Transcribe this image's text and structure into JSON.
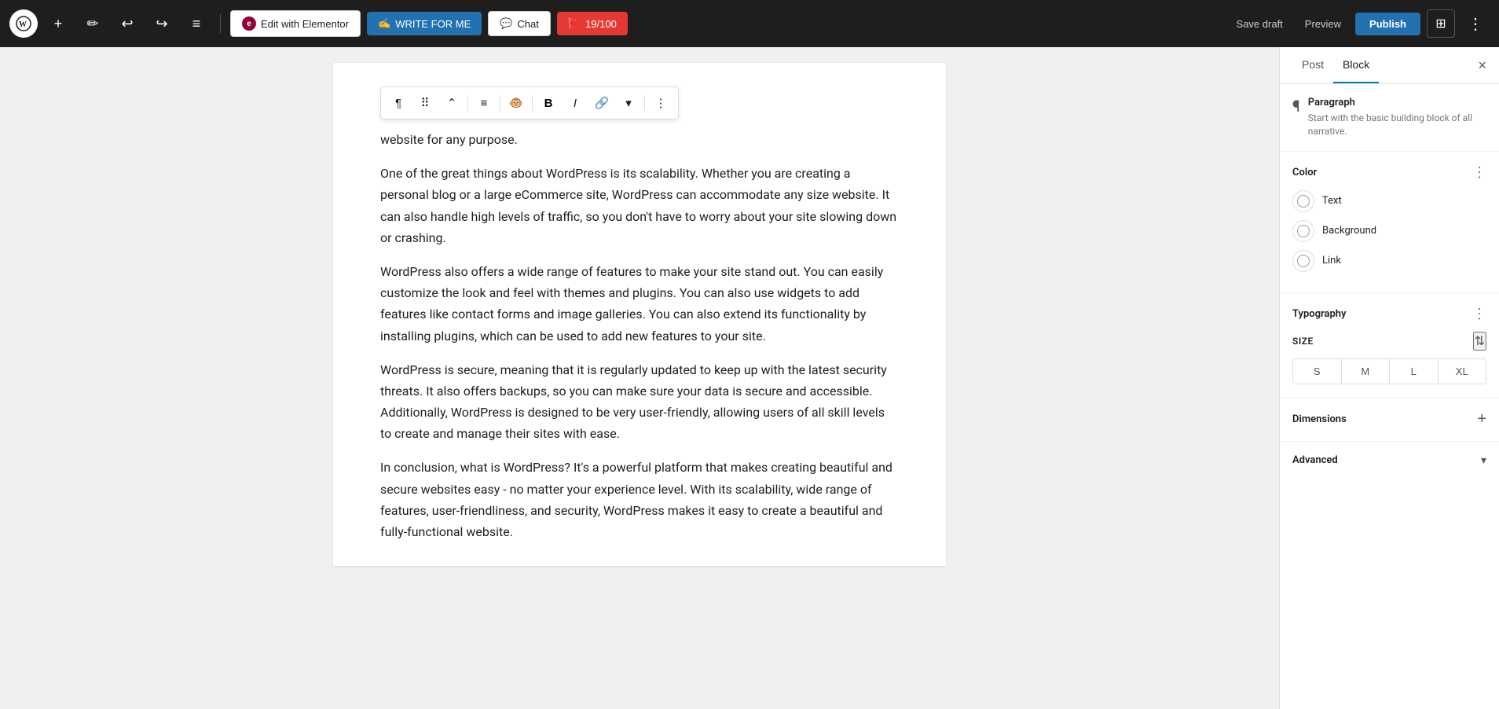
{
  "toolbar": {
    "elementor_btn": "Edit with Elementor",
    "write_btn": "WRITE FOR ME",
    "chat_btn": "Chat",
    "counter_label": "19/100",
    "save_draft_label": "Save draft",
    "preview_label": "Preview",
    "publish_label": "Publish"
  },
  "block_toolbar": {
    "paragraph_icon": "¶",
    "drag_icon": "⠿",
    "move_up_icon": "⌃",
    "align_icon": "≡",
    "avatar_icon": "🐵",
    "bold_icon": "B",
    "italic_icon": "I",
    "link_icon": "🔗",
    "dropdown_icon": "▾",
    "more_icon": "⋮"
  },
  "editor": {
    "content": [
      "website for any purpose.",
      "One of the great things about WordPress is its scalability. Whether you are creating a personal blog or a large eCommerce site, WordPress can accommodate any size website. It can also handle high levels of traffic, so you don't have to worry about your site slowing down or crashing.",
      " WordPress also offers a wide range of features to make your site stand out. You can easily customize the look and feel with themes and plugins. You can also use widgets to add features like contact forms and image galleries. You can also extend its functionality by installing plugins, which can be used to add new features to your site.",
      " WordPress is secure, meaning that it is regularly updated to keep up with the latest security threats. It also offers backups, so you can make sure your data is secure and accessible. Additionally, WordPress is designed to be very user-friendly, allowing users of all skill levels to create and manage their sites with ease.",
      " In conclusion, what is WordPress? It's a powerful platform that makes creating beautiful and secure websites easy - no matter your experience level. With its scalability, wide range of features, user-friendliness, and security, WordPress makes it easy to create a beautiful and fully-functional website."
    ]
  },
  "sidebar": {
    "tab_post": "Post",
    "tab_block": "Block",
    "close_label": "×",
    "paragraph_title": "Paragraph",
    "paragraph_desc": "Start with the basic building block of all narrative.",
    "color_section_title": "Color",
    "text_label": "Text",
    "background_label": "Background",
    "link_label": "Link",
    "typography_section_title": "Typography",
    "size_label": "SIZE",
    "size_s": "S",
    "size_m": "M",
    "size_l": "L",
    "size_xl": "XL",
    "dimensions_title": "Dimensions",
    "advanced_title": "Advanced"
  },
  "icons": {
    "plus": "+",
    "pencil": "✏",
    "undo": "↩",
    "redo": "↪",
    "list": "≡",
    "three_dots_v": "⋮",
    "three_dots_h": "⋯",
    "chevron_down": "▾",
    "close": "×",
    "settings_sliders": "⚙"
  }
}
